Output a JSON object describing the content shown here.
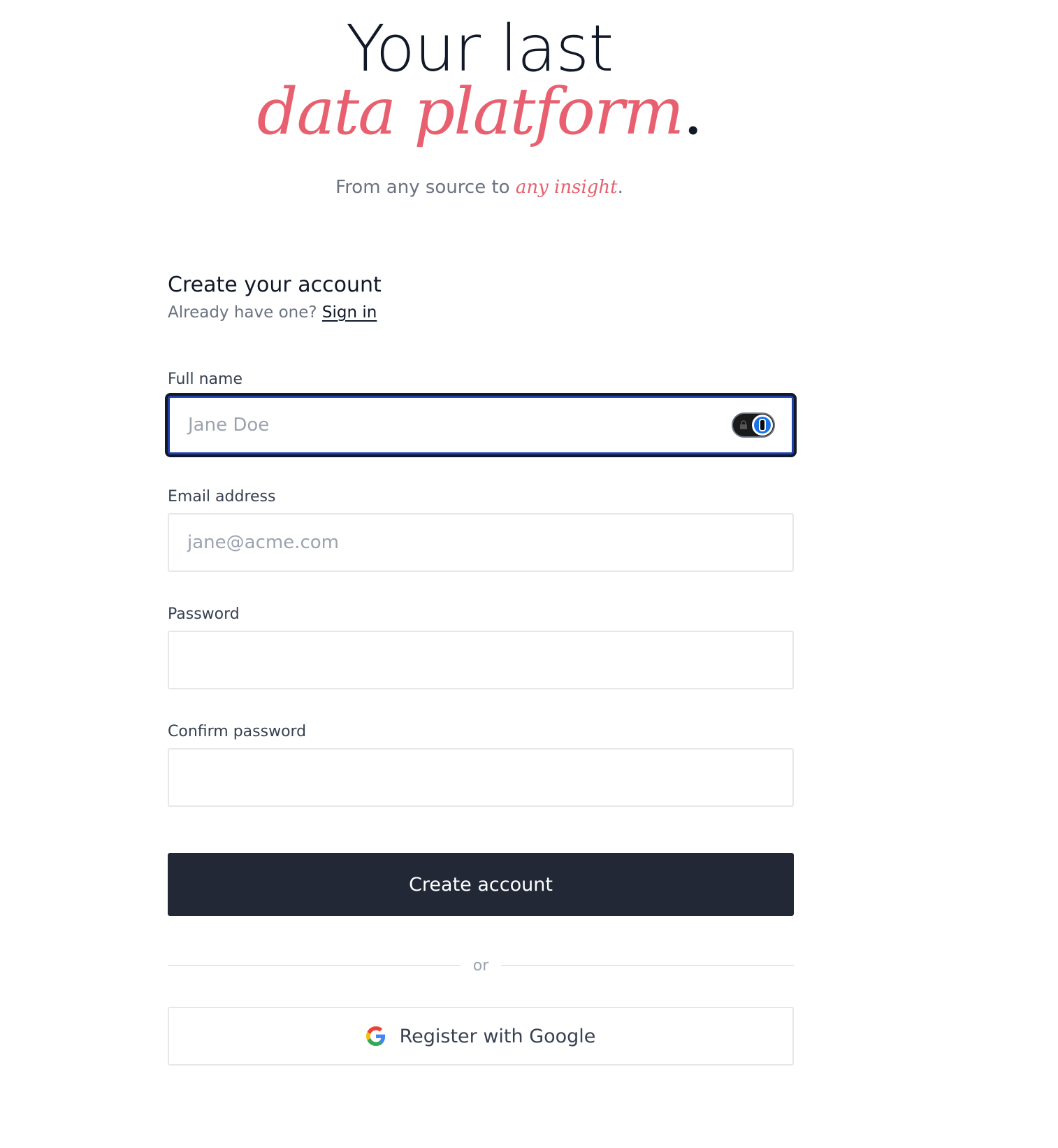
{
  "hero": {
    "line1": "Your last",
    "line2": "data platform",
    "line2_period": ".",
    "subtitle_prefix": "From any source to ",
    "subtitle_accent": "any insight",
    "subtitle_suffix": "."
  },
  "form": {
    "title": "Create your account",
    "signin_prompt": "Already have one?",
    "signin_link": "Sign in",
    "fields": {
      "full_name": {
        "label": "Full name",
        "placeholder": "Jane Doe",
        "value": ""
      },
      "email": {
        "label": "Email address",
        "placeholder": "jane@acme.com",
        "value": ""
      },
      "password": {
        "label": "Password",
        "placeholder": "",
        "value": ""
      },
      "confirm_password": {
        "label": "Confirm password",
        "placeholder": "",
        "value": ""
      }
    },
    "submit_label": "Create account",
    "divider_text": "or",
    "google_label": "Register with Google"
  },
  "icons": {
    "password_manager": "password-manager-icon",
    "google": "google-icon"
  },
  "colors": {
    "accent": "#e8606f",
    "primary_button": "#232836",
    "focus_ring": "#1e40af"
  }
}
